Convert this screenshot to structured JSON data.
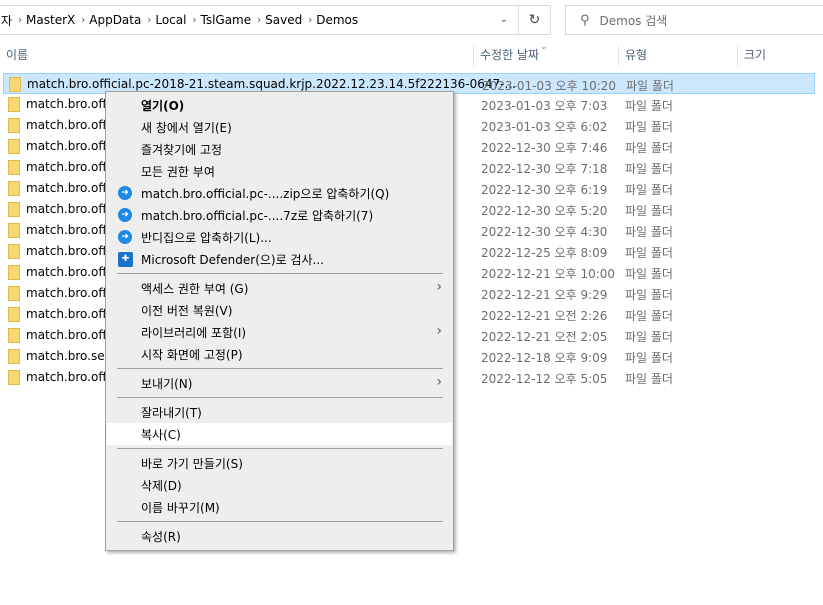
{
  "address": {
    "crumbs": [
      "자",
      "MasterX",
      "AppData",
      "Local",
      "TslGame",
      "Saved",
      "Demos"
    ]
  },
  "search": {
    "placeholder": "Demos 검색"
  },
  "columns": {
    "name": "이름",
    "date": "수정한 날짜",
    "type": "유형",
    "size": "크기"
  },
  "rows": [
    {
      "name": "match.bro.official.pc-2018-21.steam.squad.krjp.2022.12.23.14.5f222136-0647-...",
      "date": "2023-01-03 오후 10:20",
      "type": "파일 폴더"
    },
    {
      "name": "match.bro.offic",
      "date": "2023-01-03 오후 7:03",
      "type": "파일 폴더"
    },
    {
      "name": "match.bro.offic",
      "date": "2023-01-03 오후 6:02",
      "type": "파일 폴더"
    },
    {
      "name": "match.bro.offic",
      "date": "2022-12-30 오후 7:46",
      "type": "파일 폴더"
    },
    {
      "name": "match.bro.offic",
      "date": "2022-12-30 오후 7:18",
      "type": "파일 폴더"
    },
    {
      "name": "match.bro.offic",
      "date": "2022-12-30 오후 6:19",
      "type": "파일 폴더"
    },
    {
      "name": "match.bro.offic",
      "date": "2022-12-30 오후 5:20",
      "type": "파일 폴더"
    },
    {
      "name": "match.bro.offic",
      "date": "2022-12-30 오후 4:30",
      "type": "파일 폴더"
    },
    {
      "name": "match.bro.offic",
      "date": "2022-12-25 오후 8:09",
      "type": "파일 폴더"
    },
    {
      "name": "match.bro.offic",
      "date": "2022-12-21 오후 10:00",
      "type": "파일 폴더"
    },
    {
      "name": "match.bro.offic",
      "date": "2022-12-21 오후 9:29",
      "type": "파일 폴더"
    },
    {
      "name": "match.bro.offic",
      "date": "2022-12-21 오전 2:26",
      "type": "파일 폴더"
    },
    {
      "name": "match.bro.offic",
      "date": "2022-12-21 오전 2:05",
      "type": "파일 폴더"
    },
    {
      "name": "match.bro.seas",
      "date": "2022-12-18 오후 9:09",
      "type": "파일 폴더"
    },
    {
      "name": "match.bro.offic",
      "date": "2022-12-12 오후 5:05",
      "type": "파일 폴더"
    }
  ],
  "menu": [
    {
      "label": "열기(O)",
      "bold": true
    },
    {
      "label": "새 창에서 열기(E)"
    },
    {
      "label": "즐겨찾기에 고정"
    },
    {
      "label": "모든 권한 부여"
    },
    {
      "label": "match.bro.official.pc-....zip으로 압축하기(Q)",
      "icon": "bandizip-icon"
    },
    {
      "label": "match.bro.official.pc-....7z로 압축하기(7)",
      "icon": "bandizip-icon"
    },
    {
      "label": "반디집으로 압축하기(L)...",
      "icon": "bandizip-icon"
    },
    {
      "label": "Microsoft Defender(으)로 검사...",
      "icon": "defender-shield-icon"
    },
    {
      "sep": true
    },
    {
      "label": "액세스 권한 부여 (G)",
      "submenu": true
    },
    {
      "label": "이전 버전 복원(V)"
    },
    {
      "label": "라이브러리에 포함(I)",
      "submenu": true
    },
    {
      "label": "시작 화면에 고정(P)"
    },
    {
      "sep": true
    },
    {
      "label": "보내기(N)",
      "submenu": true
    },
    {
      "sep": true
    },
    {
      "label": "잘라내기(T)"
    },
    {
      "label": "복사(C)",
      "highlight": true
    },
    {
      "sep": true
    },
    {
      "label": "바로 가기 만들기(S)"
    },
    {
      "label": "삭제(D)"
    },
    {
      "label": "이름 바꾸기(M)"
    },
    {
      "sep": true
    },
    {
      "label": "속성(R)"
    }
  ]
}
